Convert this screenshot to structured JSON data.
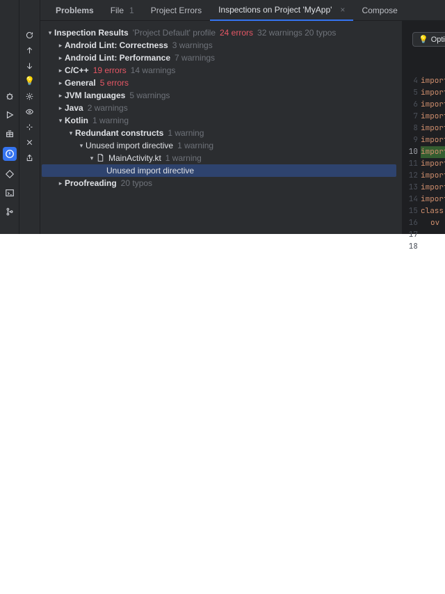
{
  "tabs": [
    {
      "label": "Problems",
      "bold": true
    },
    {
      "label": "File",
      "count": "1"
    },
    {
      "label": "Project Errors"
    },
    {
      "label": "Inspections on Project 'MyApp'",
      "closable": true,
      "active": true
    },
    {
      "label": "Compose"
    }
  ],
  "optimize": {
    "label": "Opti",
    "icon": "💡"
  },
  "tree": {
    "root": {
      "label": "Inspection Results",
      "profile": "'Project Default' profile",
      "errors": "24 errors",
      "warnings": "32 warnings",
      "typos": "20 typos"
    },
    "items": [
      {
        "label": "Android Lint: Correctness",
        "suffix": "3 warnings",
        "indent": 1,
        "chev": "right"
      },
      {
        "label": "Android Lint: Performance",
        "suffix": "7 warnings",
        "indent": 1,
        "chev": "right"
      },
      {
        "label": "C/C++",
        "errors": "19 errors",
        "suffix": "14 warnings",
        "indent": 1,
        "chev": "right"
      },
      {
        "label": "General",
        "errors": "5 errors",
        "indent": 1,
        "chev": "right"
      },
      {
        "label": "JVM languages",
        "suffix": "5 warnings",
        "indent": 1,
        "chev": "right"
      },
      {
        "label": "Java",
        "suffix": "2 warnings",
        "indent": 1,
        "chev": "right"
      },
      {
        "label": "Kotlin",
        "suffix": "1 warning",
        "indent": 1,
        "chev": "down"
      },
      {
        "label": "Redundant constructs",
        "suffix": "1 warning",
        "indent": 2,
        "chev": "down"
      },
      {
        "label": "Unused import directive",
        "suffix": "1 warning",
        "indent": 3,
        "chev": "down",
        "normal": true
      },
      {
        "label": "MainActivity.kt",
        "suffix": "1 warning",
        "indent": 4,
        "chev": "down",
        "file": true,
        "normal": true
      },
      {
        "label": "Unused import directive",
        "indent": 5,
        "selected": true,
        "normal": true
      },
      {
        "label": "Proofreading",
        "suffix": "20 typos",
        "indent": 1,
        "chev": "right"
      }
    ]
  },
  "gutter": [
    "4",
    "5",
    "6",
    "7",
    "8",
    "9",
    "10",
    "11",
    "12",
    "13",
    "14",
    "15",
    "16",
    "17",
    "18"
  ],
  "gutter_hl": "10",
  "code": {
    "imports": [
      "import",
      "import",
      "import",
      "import",
      "import",
      "import",
      "import",
      "import",
      "import",
      "import",
      "import"
    ],
    "hl_index": 6,
    "class_kw": "class",
    "ov_kw": "ov"
  }
}
